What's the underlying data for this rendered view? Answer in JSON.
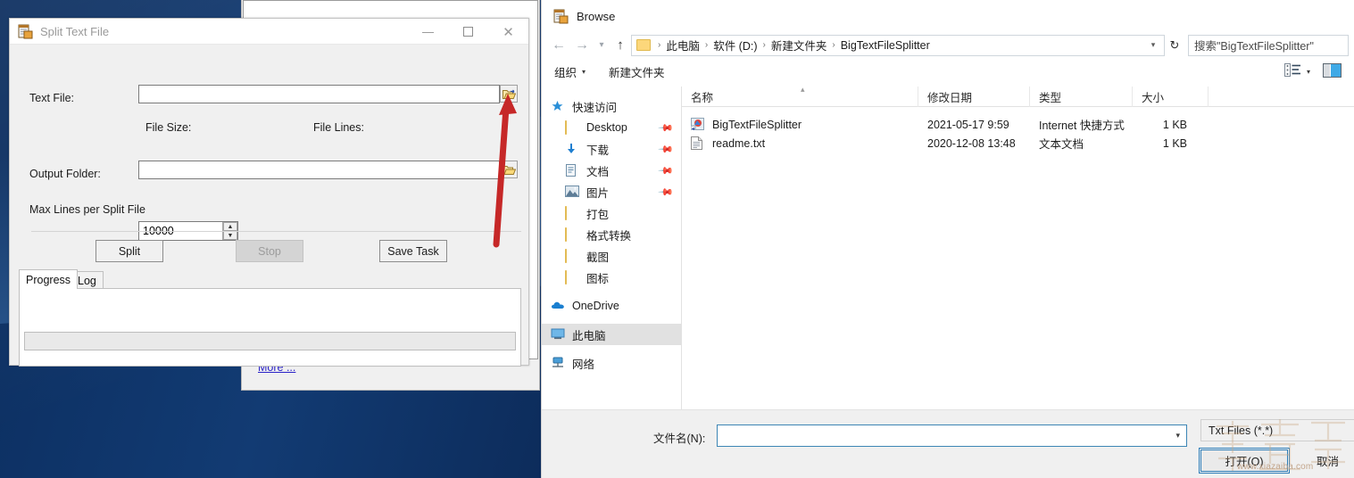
{
  "split_dialog": {
    "title": "Split Text File",
    "icon": "document-split-icon",
    "window_buttons": {
      "minimize": "—",
      "maximize": "☐",
      "close": "✕"
    },
    "fields": {
      "text_file_label": "Text File:",
      "text_file_value": "",
      "browse_text_file_icon": "open-folder-icon",
      "file_size_label": "File Size:",
      "file_size_value": "",
      "file_lines_label": "File Lines:",
      "file_lines_value": "",
      "output_folder_label": "Output Folder:",
      "output_folder_value": "",
      "browse_output_folder_icon": "folder-icon",
      "max_lines_label": "Max Lines per Split File",
      "max_lines_value": "10000",
      "spinner_up": "▲",
      "spinner_down": "▼"
    },
    "buttons": {
      "split": "Split",
      "stop": "Stop",
      "save_task": "Save Task"
    },
    "tabs": [
      {
        "label": "Progress",
        "active": true
      },
      {
        "label": "Log",
        "active": false
      }
    ],
    "progress_value": ""
  },
  "background_window": {
    "more_link": "More ..."
  },
  "annotation": {
    "arrow_color": "#c62828",
    "points_to": "browse-text-file-button"
  },
  "browse_dialog": {
    "title": "Browse",
    "icon": "document-split-icon",
    "nav": {
      "back_icon": "arrow-left-icon",
      "forward_icon": "arrow-right-icon",
      "recent_icon": "chevron-down-icon",
      "up_icon": "arrow-up-icon",
      "refresh_icon": "refresh-icon",
      "dropdown_icon": "chevron-down-icon"
    },
    "breadcrumb": [
      "此电脑",
      "软件 (D:)",
      "新建文件夹",
      "BigTextFileSplitter"
    ],
    "breadcrumb_separator": "›",
    "search_placeholder": "搜索\"BigTextFileSplitter\"",
    "command_bar": {
      "organize": "组织",
      "organize_caret": "▾",
      "new_folder": "新建文件夹",
      "view_icon": "view-list-icon",
      "view_caret": "▾",
      "preview_pane_icon": "preview-pane-icon"
    },
    "nav_pane": [
      {
        "label": "快速访问",
        "icon": "star-icon",
        "indent": false,
        "pinned": false,
        "selected": false
      },
      {
        "label": "Desktop",
        "icon": "folder-icon",
        "indent": true,
        "pinned": true,
        "selected": false
      },
      {
        "label": "下载",
        "icon": "download-icon",
        "indent": true,
        "pinned": true,
        "selected": false
      },
      {
        "label": "文档",
        "icon": "documents-icon",
        "indent": true,
        "pinned": true,
        "selected": false
      },
      {
        "label": "图片",
        "icon": "pictures-icon",
        "indent": true,
        "pinned": true,
        "selected": false
      },
      {
        "label": "打包",
        "icon": "folder-icon",
        "indent": true,
        "pinned": false,
        "selected": false
      },
      {
        "label": "格式转换",
        "icon": "folder-icon",
        "indent": true,
        "pinned": false,
        "selected": false
      },
      {
        "label": "截图",
        "icon": "folder-icon",
        "indent": true,
        "pinned": false,
        "selected": false
      },
      {
        "label": "图标",
        "icon": "folder-icon",
        "indent": true,
        "pinned": false,
        "selected": false
      },
      {
        "label": "OneDrive",
        "icon": "cloud-icon",
        "indent": false,
        "pinned": false,
        "selected": false
      },
      {
        "label": "此电脑",
        "icon": "computer-icon",
        "indent": false,
        "pinned": false,
        "selected": true
      },
      {
        "label": "网络",
        "icon": "network-icon",
        "indent": false,
        "pinned": false,
        "selected": false
      }
    ],
    "columns": [
      "名称",
      "修改日期",
      "类型",
      "大小"
    ],
    "sort_caret": "▴",
    "files": [
      {
        "name": "BigTextFileSplitter",
        "modified": "2021-05-17 9:59",
        "type": "Internet 快捷方式",
        "size": "1 KB",
        "icon": "internet-shortcut-icon"
      },
      {
        "name": "readme.txt",
        "modified": "2020-12-08 13:48",
        "type": "文本文档",
        "size": "1 KB",
        "icon": "text-file-icon"
      }
    ],
    "footer": {
      "filename_label": "文件名(N):",
      "filename_value": "",
      "filename_caret": "▾",
      "filter_value": "Txt Files (*.*)",
      "open_button": "打开(O)",
      "cancel_button": "取消"
    }
  },
  "watermark": {
    "url": "www.xiazaiba.com",
    "logo": "下载吧"
  }
}
